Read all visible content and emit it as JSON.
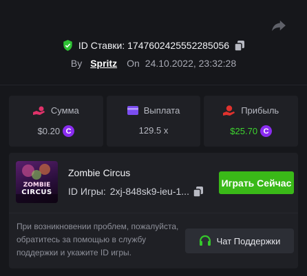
{
  "bet": {
    "id_label": "ID Ставки:",
    "id_value": "1747602425552285056",
    "by_label": "By",
    "user": "Spritz",
    "on_label": "On",
    "date": "24.10.2022, 23:32:28"
  },
  "stats": [
    {
      "label": "Сумма",
      "value": "$0.20",
      "icon": "coins-hand-icon",
      "coin": true
    },
    {
      "label": "Выплата",
      "value": "129.5 x",
      "icon": "card-icon",
      "coin": false
    },
    {
      "label": "Прибыль",
      "value": "$25.70",
      "icon": "profit-icon",
      "coin": true
    }
  ],
  "coin_symbol": "C",
  "game": {
    "thumb_line1": "ZOMBIE",
    "thumb_line2": "CIRCUS",
    "title": "Zombie Circus",
    "id_label": "ID Игры:",
    "id_value": "2xj-848sk9-ieu-1...",
    "play_label": "Играть Сейчас"
  },
  "support": {
    "help_text": "При возникновении проблем, пожалуйста, обратитесь за помощью в службу поддержки и укажите ID игры.",
    "button_label": "Чат Поддержки"
  },
  "colors": {
    "accent_green": "#3ab918",
    "profit_green": "#3ed62f",
    "coin_purple": "#8a2cf0",
    "pink": "#e0326a",
    "violet": "#7b4df0",
    "red": "#e0322e"
  }
}
